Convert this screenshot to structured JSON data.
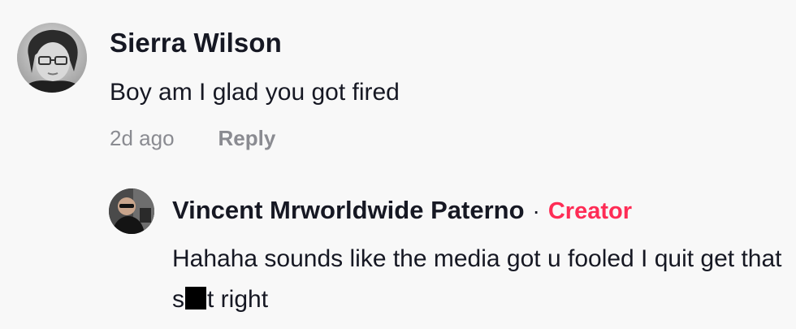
{
  "comment": {
    "author": "Sierra Wilson",
    "text": "Boy am I glad you got fired",
    "timestamp": "2d ago",
    "reply_label": "Reply"
  },
  "reply": {
    "author": "Vincent Mrworldwide Paterno",
    "separator": "·",
    "badge": "Creator",
    "text_before": "Hahaha sounds like the media got u fooled I quit get that s",
    "text_after": "t right"
  },
  "colors": {
    "background": "#f8f8f8",
    "text": "#161823",
    "muted": "#8a8b91",
    "creator_accent": "#fe2c55"
  }
}
